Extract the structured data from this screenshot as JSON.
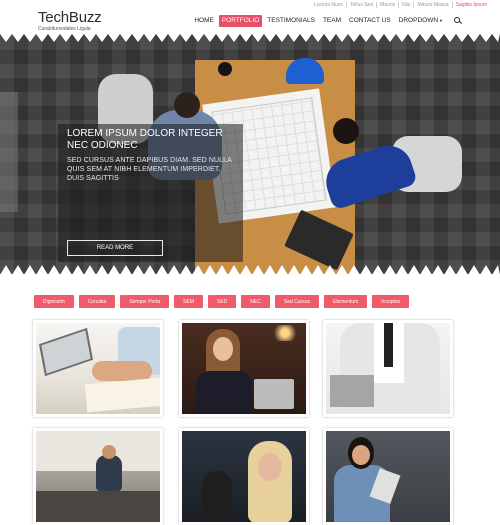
{
  "toplinks": [
    "Lacinia Nunc",
    "Tellus Sed",
    "Mauris",
    "Nisi",
    "Mauris Massa",
    "Sagittis Ipsum"
  ],
  "brand": {
    "title": "TechBuzz",
    "subtitle": "Curabitursodales Ligula"
  },
  "nav": {
    "items": [
      "HOME",
      "PORTFOLIO",
      "TESTIMONIALS",
      "TEAM",
      "CONTACT US",
      "DROPDOWN"
    ],
    "active": "PORTFOLIO",
    "dropdown_caret": "▼",
    "search_icon": "search-icon"
  },
  "hero": {
    "title": "LOREM IPSUM DOLOR INTEGER NEC ODIONEC",
    "text": "SED CURSUS ANTE DAPIBUS DIAM. SED NULLA QUIS SEM AT NIBH ELEMENTUM IMPERDIET. DUIS SAGITTIS",
    "button": "READ MORE"
  },
  "filters": [
    "Dignissim",
    "Conubia",
    "Semper Porta",
    "SEM",
    "SED",
    "NEC",
    "Sed Cursus",
    "Elementum",
    "Inceptos"
  ],
  "colors": {
    "accent": "#ef5b6a",
    "active_nav": "#e8506a"
  }
}
